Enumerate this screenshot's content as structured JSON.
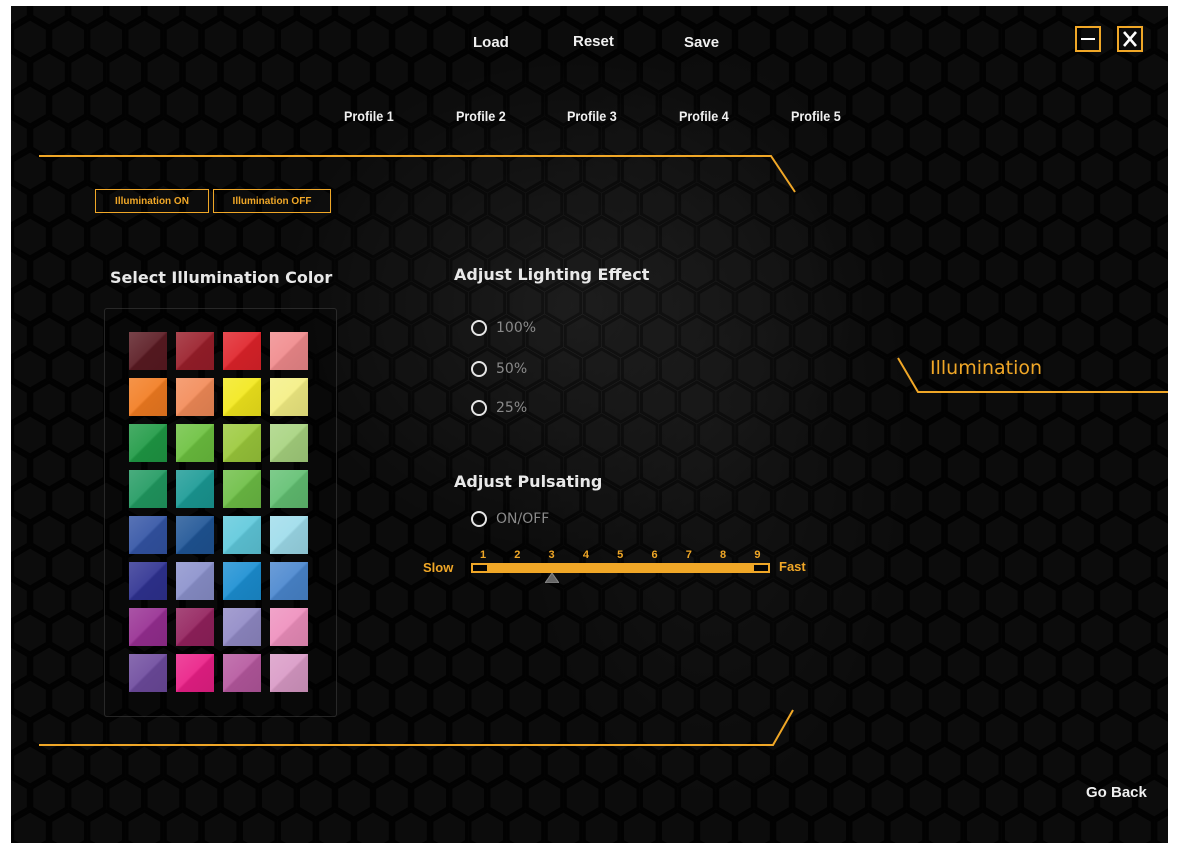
{
  "header": {
    "actions": [
      {
        "label": "Load"
      },
      {
        "label": "Reset"
      },
      {
        "label": "Save"
      }
    ],
    "profiles": [
      {
        "label": "Profile 1"
      },
      {
        "label": "Profile 2"
      },
      {
        "label": "Profile 3"
      },
      {
        "label": "Profile 4"
      },
      {
        "label": "Profile 5"
      }
    ],
    "window_controls": {
      "minimize": "minimize-icon",
      "close": "close-icon"
    }
  },
  "illumination_toggle": {
    "on_label": "Illumination ON",
    "off_label": "Illumination OFF"
  },
  "color_picker": {
    "title": "Select Illumination Color",
    "colors": [
      [
        "#5a1a22",
        "#9a1e2a",
        "#e0232a",
        "#f08a8c"
      ],
      [
        "#f27c21",
        "#f38b58",
        "#f3e81c",
        "#f4ef84"
      ],
      [
        "#1f9a45",
        "#6cc13f",
        "#9bc93b",
        "#a7d37f"
      ],
      [
        "#219a61",
        "#1a9a95",
        "#6dbe45",
        "#62c072"
      ],
      [
        "#3354a5",
        "#1f5596",
        "#5fc9dc",
        "#9edceb"
      ],
      [
        "#2f3292",
        "#8b91cc",
        "#1b8fd3",
        "#4a87cf"
      ],
      [
        "#972e92",
        "#93215d",
        "#918ac6",
        "#ee8fbd"
      ],
      [
        "#6e4b9e",
        "#ea1f87",
        "#b6589f",
        "#d99ac6"
      ]
    ]
  },
  "lighting_effect": {
    "title": "Adjust Lighting Effect",
    "options": [
      {
        "label": "100%"
      },
      {
        "label": "50%"
      },
      {
        "label": "25%"
      }
    ]
  },
  "pulsating": {
    "title": "Adjust Pulsating",
    "toggle_label": "ON/OFF",
    "slow_label": "Slow",
    "fast_label": "Fast",
    "ticks": [
      "1",
      "2",
      "3",
      "4",
      "5",
      "6",
      "7",
      "8",
      "9"
    ],
    "selected_value": 3
  },
  "side_section": {
    "title": "Illumination"
  },
  "footer": {
    "go_back": "Go Back"
  },
  "colors": {
    "accent": "#f0a727",
    "background": "#050505"
  }
}
